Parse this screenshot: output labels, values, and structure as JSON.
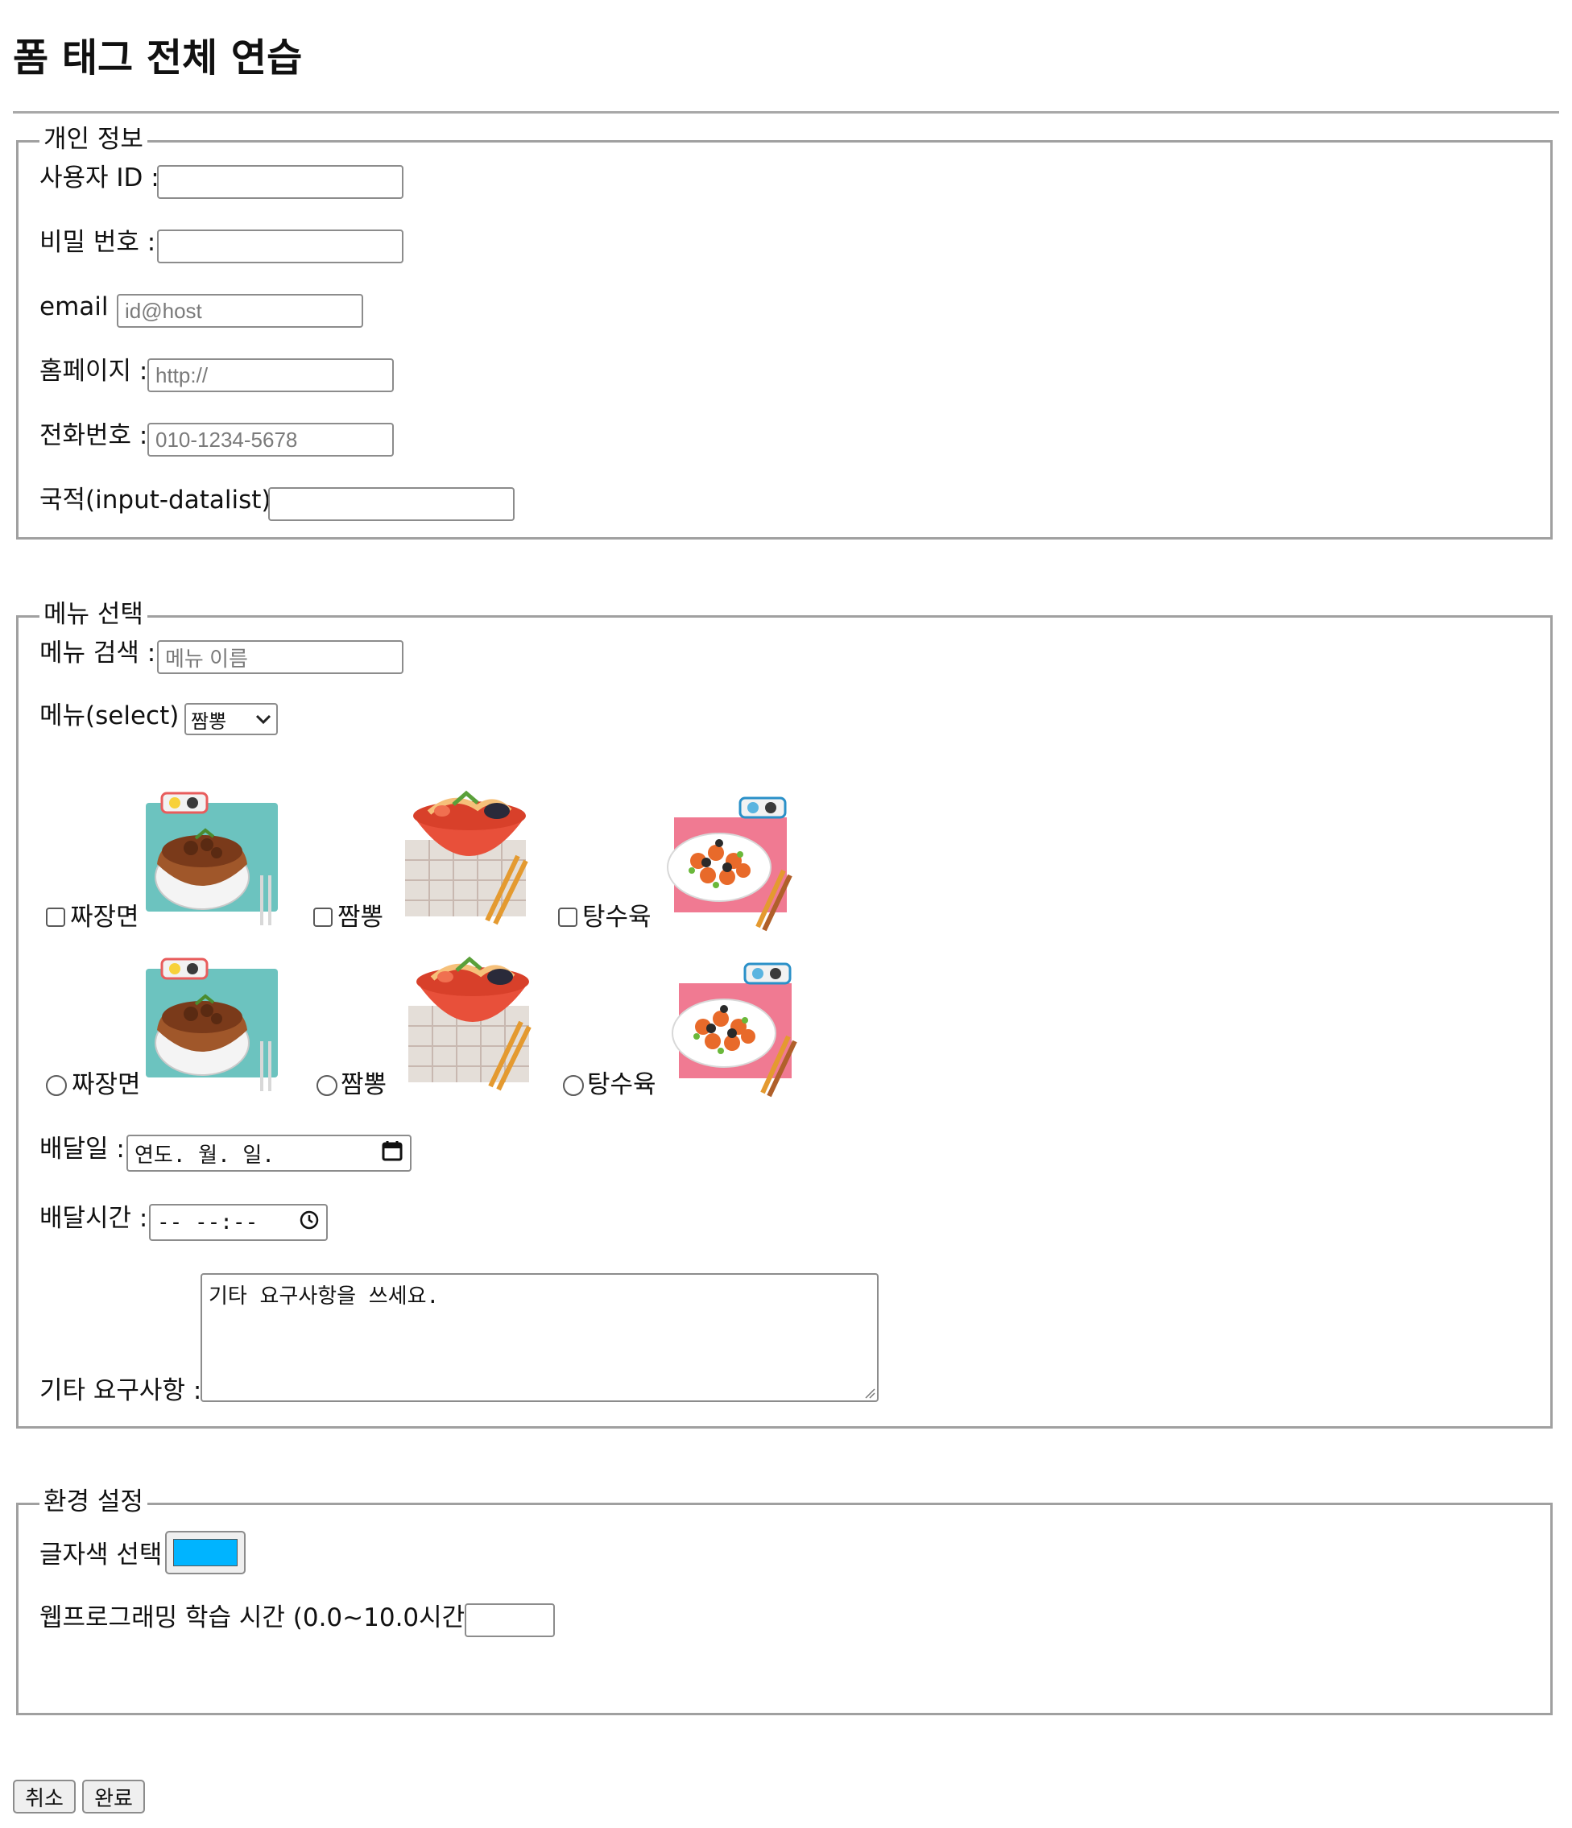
{
  "page_title": "폼 태그 전체 연습",
  "personal": {
    "legend": "개인 정보",
    "user_id_label": "사용자 ID :",
    "user_id_value": "",
    "password_label": "비밀 번호 :",
    "password_value": "",
    "email_label": "email :",
    "email_placeholder": "id@host",
    "homepage_label": "홈페이지 :",
    "homepage_placeholder": "http://",
    "phone_label": "전화번호 :",
    "phone_placeholder": "010-1234-5678",
    "nationality_label": "국적(input-datalist) :",
    "nationality_value": ""
  },
  "menu": {
    "legend": "메뉴 선택",
    "search_label": "메뉴 검색 :",
    "search_placeholder": "메뉴 이름",
    "select_label": "메뉴(select) :",
    "select_value": "짬뽕",
    "checkbox_items": [
      {
        "label": "짜장면",
        "checked": false
      },
      {
        "label": "짬뽕",
        "checked": false
      },
      {
        "label": "탕수육",
        "checked": false
      }
    ],
    "radio_items": [
      {
        "label": "짜장면",
        "checked": false
      },
      {
        "label": "짬뽕",
        "checked": false
      },
      {
        "label": "탕수육",
        "checked": false
      }
    ],
    "date_label": "배달일 :",
    "date_value": "연도. 월. 일.",
    "time_label": "배달시간 :",
    "time_value": "-- --:--",
    "notes_label": "기타 요구사항 :",
    "notes_value": "기타 요구사항을 쓰세요."
  },
  "settings": {
    "legend": "환경 설정",
    "color_label": "글자색 선택",
    "color_value": "#00b4ff",
    "study_label": "웹프로그래밍 학습 시간 (0.0~10.0시간) :",
    "study_value": ""
  },
  "buttons": {
    "cancel": "취소",
    "submit": "완료"
  },
  "icons": {
    "dropdown": "chevron-down-icon",
    "calendar": "calendar-icon",
    "clock": "clock-icon"
  }
}
